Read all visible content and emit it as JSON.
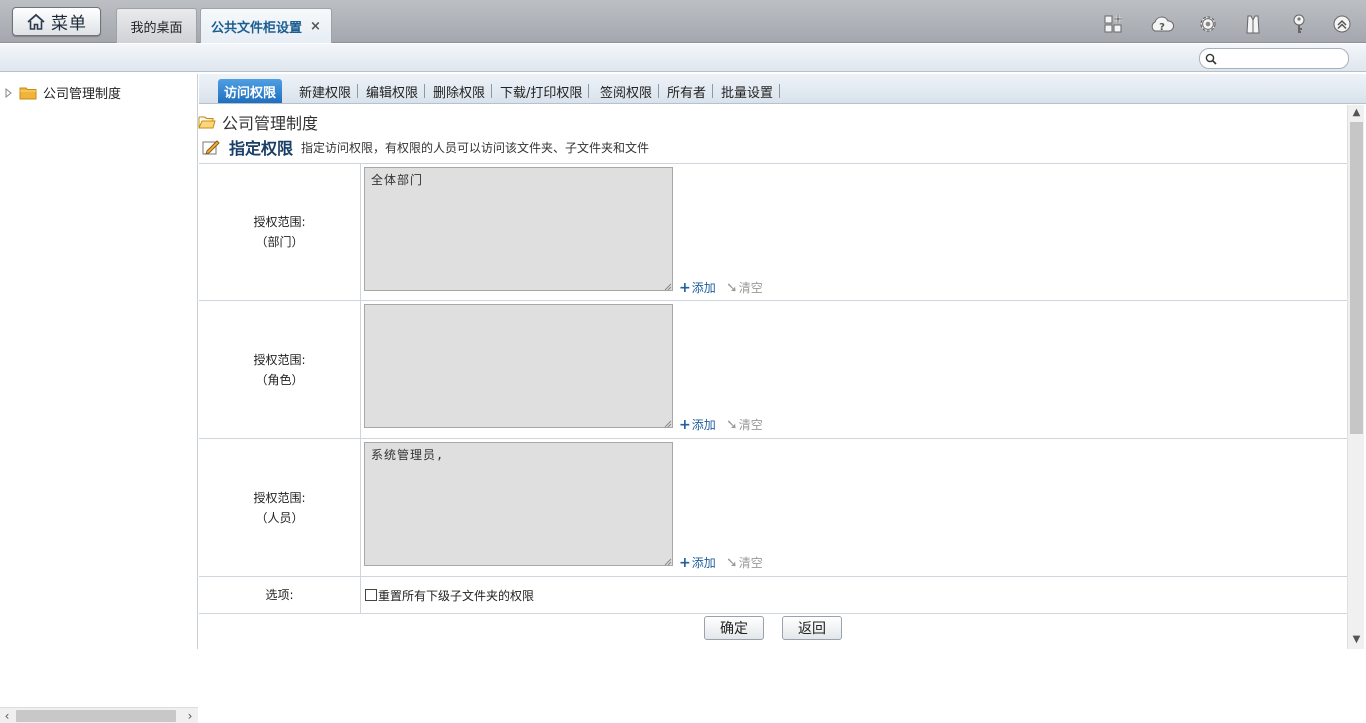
{
  "topbar": {
    "menu_label": "菜单",
    "tabs": [
      {
        "label": "我的桌面"
      },
      {
        "label": "公共文件柜设置",
        "close": "×"
      }
    ],
    "tools": [
      "add-widget-icon",
      "cloud-help-icon",
      "gear-icon",
      "shirt-theme-icon",
      "key-icon",
      "collapse-up-icon"
    ]
  },
  "search": {
    "value": "",
    "placeholder": ""
  },
  "tree": {
    "items": [
      {
        "label": "公司管理制度"
      }
    ]
  },
  "subtabs": [
    {
      "label": "访问权限",
      "active": true
    },
    {
      "label": "新建权限"
    },
    {
      "label": "编辑权限"
    },
    {
      "label": "删除权限"
    },
    {
      "label": "下载/打印权限"
    },
    {
      "label": "签阅权限"
    },
    {
      "label": "所有者"
    },
    {
      "label": "批量设置"
    }
  ],
  "folder_title": "公司管理制度",
  "section": {
    "title": "指定权限",
    "desc": "指定访问权限，有权限的人员可以访问该文件夹、子文件夹和文件"
  },
  "rows": [
    {
      "label1": "授权范围:",
      "label2": "（部门）",
      "value": "全体部门",
      "add": "添加",
      "clear": "清空"
    },
    {
      "label1": "授权范围:",
      "label2": "（角色）",
      "value": "",
      "add": "添加",
      "clear": "清空"
    },
    {
      "label1": "授权范围:",
      "label2": "（人员）",
      "value": "系统管理员,",
      "add": "添加",
      "clear": "清空"
    }
  ],
  "options": {
    "label": "选项:",
    "checkbox_text": "重置所有下级子文件夹的权限",
    "checked": false
  },
  "buttons": {
    "confirm": "确定",
    "back": "返回"
  },
  "colors": {
    "accent": "#1f6fbf",
    "link": "#1f5f9e",
    "topbar": "#a9adb3"
  }
}
